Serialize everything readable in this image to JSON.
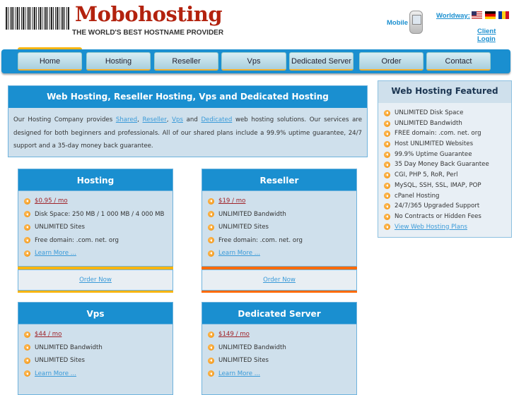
{
  "header": {
    "logo": "Mobohosting",
    "tagline": "THE WORLD'S BEST HOSTNAME PROVIDER",
    "mobile": "Mobile",
    "worldway": "Worldway:",
    "client_login": "Client Login",
    "flags": [
      "us-flag",
      "de-flag",
      "ro-flag"
    ]
  },
  "nav": [
    "Home",
    "Hosting",
    "Reseller",
    "Vps",
    "Dedicated Server",
    "Order",
    "Contact"
  ],
  "intro": {
    "title": "Web Hosting, Reseller Hosting, Vps and Dedicated Hosting",
    "t1": "Our Hosting Company provides ",
    "l1": "Shared",
    "c1": ", ",
    "l2": "Reseller",
    "c2": ", ",
    "l3": "Vps",
    "t2": " and ",
    "l4": "Dedicated",
    "t3": " web hosting solutions. Our services are designed for both beginners and professionals. All of our shared plans include a 99.9% uptime guarantee, 24/7 support and a 35-day money back guarantee."
  },
  "featured": {
    "title": "Web Hosting Featured",
    "items": [
      "UNLIMITED Disk Space",
      "UNLIMITED Bandwidth",
      "FREE domain: .com. net. org",
      "Host UNLIMITED Websites",
      "99.9% Uptime Guarantee",
      "35 Day Money Back Guarantee",
      "CGI, PHP 5, RoR, Perl",
      "MySQL, SSH, SSL, IMAP, POP",
      "cPanel Hosting",
      "24/7/365 Upgraded Support",
      "No Contracts or Hidden Fees"
    ],
    "link": "View Web Hosting Plans"
  },
  "cards": [
    {
      "title": "Hosting",
      "price": "$0.95 / mo",
      "features": [
        "Disk Space: 250 MB / 1 000 MB / 4 000 MB",
        "UNLIMITED Sites",
        "Free domain: .com. net. org"
      ],
      "more": "Learn More ...",
      "order": "Order Now"
    },
    {
      "title": "Reseller",
      "price": "$19 / mo",
      "features": [
        "UNLIMITED Bandwidth",
        "UNLIMITED Sites",
        "Free domain: .com. net. org"
      ],
      "more": "Learn More ...",
      "order": "Order Now"
    },
    {
      "title": "Vps",
      "price": "$44 / mo",
      "features": [
        "UNLIMITED Bandwidth",
        "UNLIMITED Sites"
      ],
      "more": "Learn More ..."
    },
    {
      "title": "Dedicated Server",
      "price": "$149 / mo",
      "features": [
        "UNLIMITED Bandwidth",
        "UNLIMITED Sites"
      ],
      "more": "Learn More ..."
    }
  ],
  "colors": {
    "blue": "#1a8fd0",
    "hosting_bar": "#f7b50f",
    "reseller_bar": "#ff6a00"
  }
}
